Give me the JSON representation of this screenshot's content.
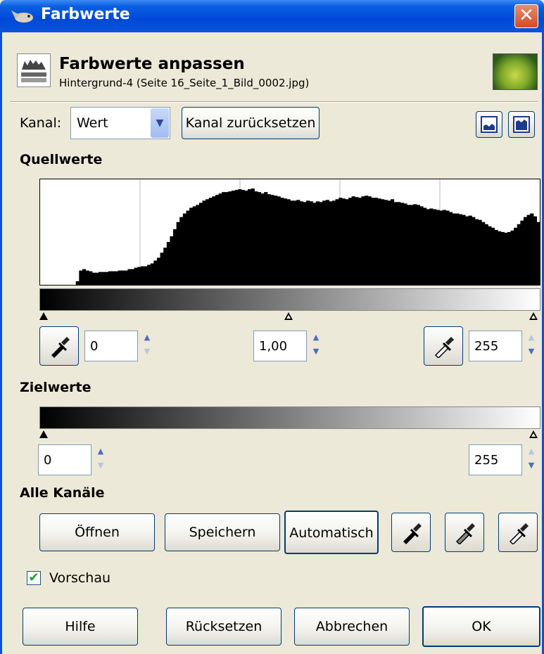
{
  "window": {
    "title": "Farbwerte",
    "close_glyph": "✕"
  },
  "header": {
    "title": "Farbwerte anpassen",
    "subtitle": "Hintergrund-4 (Seite 16_Seite_1_Bild_0002.jpg)",
    "icon": "levels-icon",
    "thumbnail": "image-thumbnail"
  },
  "channel": {
    "label": "Kanal:",
    "value": "Wert",
    "reset_label": "Kanal zurücksetzen",
    "view_linear_icon": "linear-histogram-icon",
    "view_log_icon": "logarithmic-histogram-icon"
  },
  "input_levels": {
    "section_title": "Quellwerte",
    "low": "0",
    "gamma": "1,00",
    "high": "255",
    "histogram_heights": [
      0,
      0,
      0,
      0,
      0,
      0,
      0,
      0,
      0,
      0,
      0,
      5,
      20,
      22,
      20,
      19,
      17,
      17,
      18,
      18,
      18,
      19,
      19,
      19,
      20,
      20,
      20,
      22,
      22,
      24,
      25,
      26,
      26,
      28,
      30,
      34,
      38,
      45,
      52,
      60,
      68,
      78,
      88,
      95,
      100,
      104,
      108,
      110,
      112,
      115,
      118,
      120,
      122,
      124,
      126,
      128,
      130,
      130,
      131,
      132,
      133,
      134,
      133,
      132,
      134,
      135,
      131,
      130,
      128,
      130,
      127,
      126,
      125,
      124,
      122,
      121,
      120,
      118,
      118,
      119,
      117,
      116,
      118,
      117,
      115,
      117,
      116,
      118,
      119,
      117,
      118,
      120,
      122,
      121,
      120,
      122,
      124,
      123,
      122,
      124,
      125,
      124,
      122,
      122,
      121,
      120,
      119,
      118,
      120,
      116,
      116,
      115,
      114,
      112,
      112,
      113,
      112,
      110,
      108,
      106,
      107,
      106,
      105,
      104,
      105,
      104,
      102,
      100,
      100,
      99,
      98,
      96,
      97,
      95,
      92,
      91,
      88,
      85,
      82,
      80,
      77,
      75,
      74,
      73,
      74,
      76,
      80,
      85,
      90,
      95,
      98,
      100,
      96,
      88
    ],
    "pick_black_icon": "black-point-picker-icon",
    "pick_white_icon": "white-point-picker-icon"
  },
  "output_levels": {
    "section_title": "Zielwerte",
    "low": "0",
    "high": "255"
  },
  "all_channels": {
    "section_title": "Alle Kanäle",
    "open_label": "Öffnen",
    "save_label": "Speichern",
    "auto_label": "Automatisch",
    "black_picker_icon": "black-eyedropper-icon",
    "gray_picker_icon": "gray-eyedropper-icon",
    "white_picker_icon": "white-eyedropper-icon"
  },
  "preview": {
    "label": "Vorschau",
    "checked": true,
    "check_glyph": "✔"
  },
  "buttons": {
    "help": "Hilfe",
    "reset": "Rücksetzen",
    "cancel": "Abbrechen",
    "ok": "OK"
  },
  "spin_glyphs": {
    "up": "▲",
    "down": "▼"
  }
}
